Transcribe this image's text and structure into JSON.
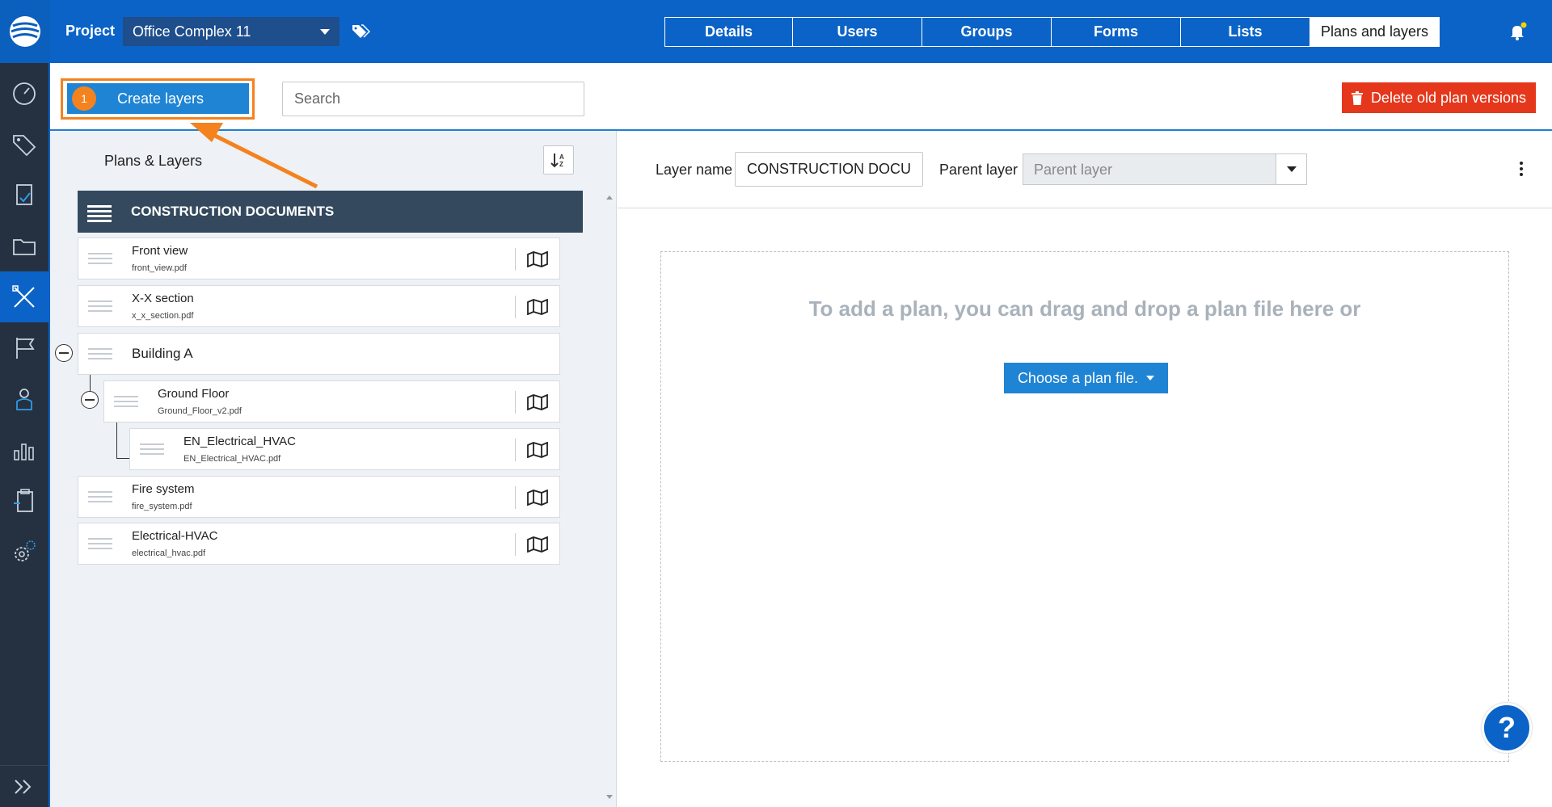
{
  "header": {
    "project_label": "Project",
    "project_value": "Office Complex 11",
    "tabs": [
      {
        "label": "Details"
      },
      {
        "label": "Users"
      },
      {
        "label": "Groups"
      },
      {
        "label": "Forms"
      },
      {
        "label": "Lists"
      },
      {
        "label": "Plans and layers",
        "active": true
      }
    ],
    "notification_dot_color": "#f5d200"
  },
  "toolbar": {
    "step_badge": "1",
    "create_label": "Create layers",
    "search_placeholder": "Search",
    "delete_label": "Delete old plan versions"
  },
  "tree": {
    "title": "Plans & Layers",
    "group_header": "CONSTRUCTION DOCUMENTS",
    "items": [
      {
        "name": "Front view",
        "file": "front_view.pdf"
      },
      {
        "name": "X-X section",
        "file": "x_x_section.pdf"
      },
      {
        "name": "Building A"
      },
      {
        "name": "Ground Floor",
        "file": "Ground_Floor_v2.pdf"
      },
      {
        "name": "EN_Electrical_HVAC",
        "file": "EN_Electrical_HVAC.pdf"
      },
      {
        "name": "Fire system",
        "file": "fire_system.pdf"
      },
      {
        "name": "Electrical-HVAC",
        "file": "electrical_hvac.pdf"
      }
    ]
  },
  "props": {
    "layer_name_label": "Layer name",
    "layer_name_value": "CONSTRUCTION DOCUMENTS",
    "parent_label": "Parent layer",
    "parent_placeholder": "Parent layer"
  },
  "dropzone": {
    "text": "To add a plan, you can drag and drop a plan file here or",
    "choose_label": "Choose a plan file."
  },
  "help": {
    "label": "?"
  },
  "colors": {
    "brand": "#0b63c7",
    "accent_orange": "#f4821f",
    "danger": "#e5371c",
    "button_blue": "#1f84d4"
  }
}
